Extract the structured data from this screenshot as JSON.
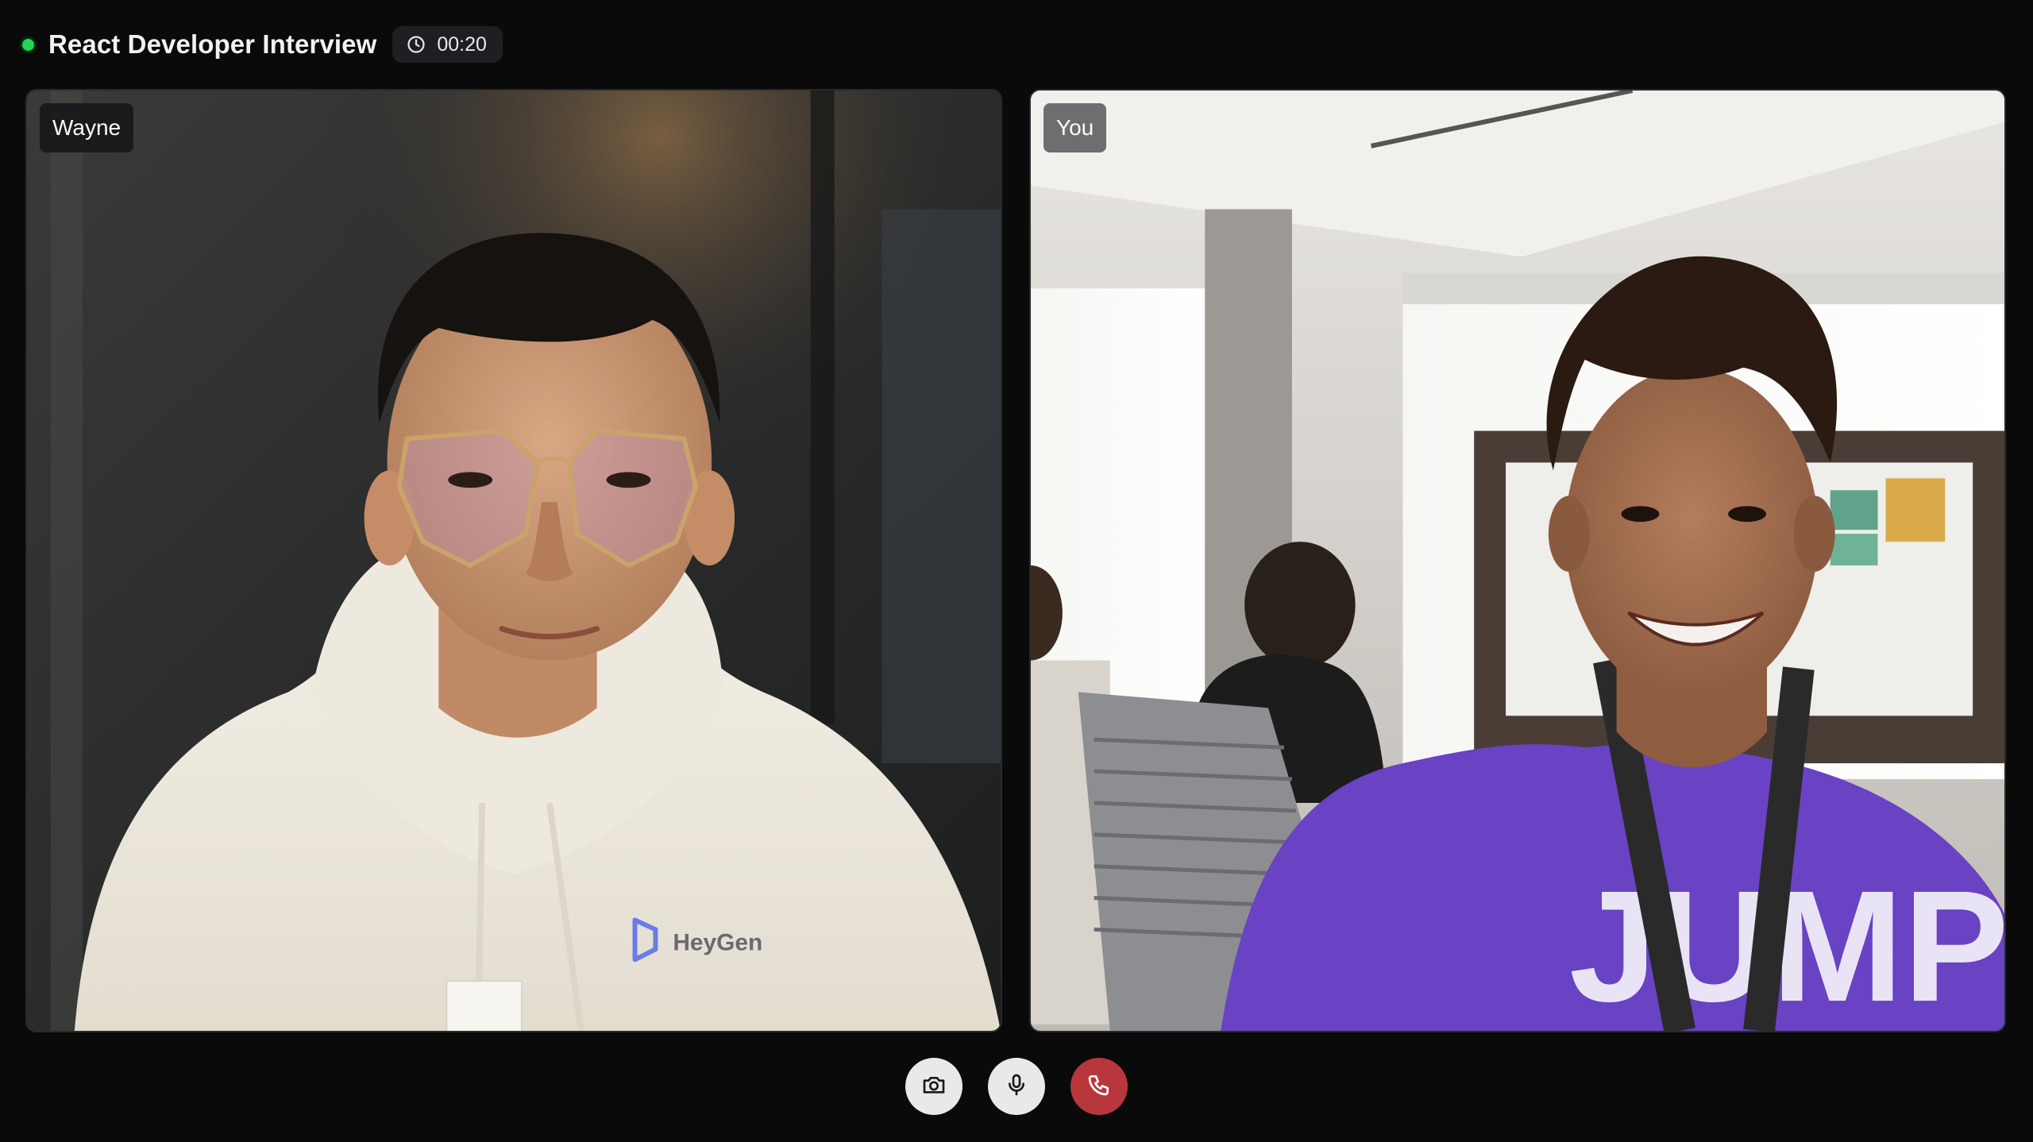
{
  "header": {
    "title": "React Developer Interview",
    "timer": "00:20",
    "live_color": "#1fd655"
  },
  "participants": [
    {
      "name": "Wayne",
      "shirt_logo": "HeyGen"
    },
    {
      "name": "You",
      "shirt_text": "JUMP"
    }
  ],
  "controls": {
    "camera_icon": "camera-icon",
    "mic_icon": "microphone-icon",
    "hangup_icon": "phone-icon",
    "hangup_color": "#b7373c"
  }
}
